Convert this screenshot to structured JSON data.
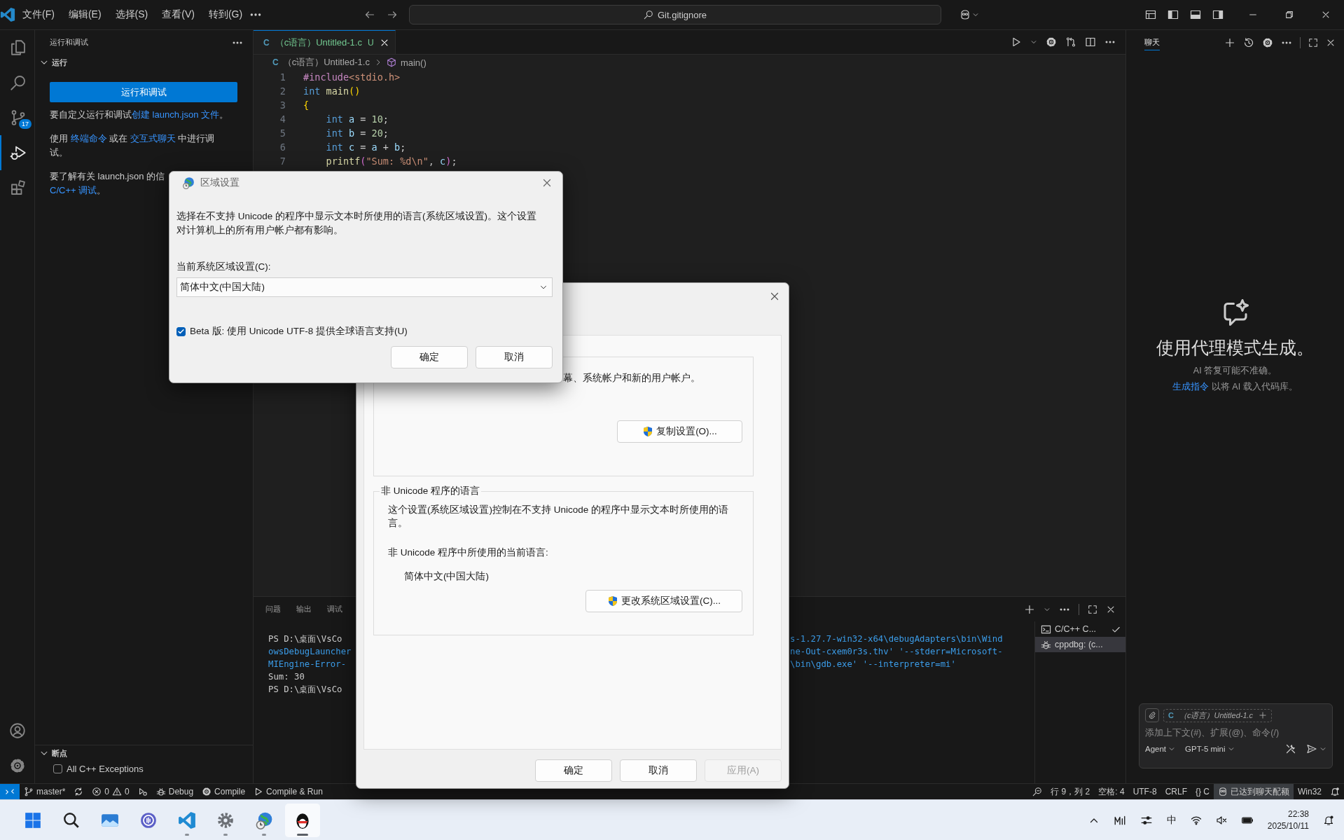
{
  "title_bar": {
    "menus": [
      "文件(F)",
      "编辑(E)",
      "选择(S)",
      "查看(V)",
      "转到(G)"
    ],
    "search": "Git.gitignore"
  },
  "activity_bar": {
    "items": [
      {
        "selected": false
      },
      {
        "selected": false
      },
      {
        "selected": false,
        "badge": "17"
      },
      {
        "selected": true
      },
      {
        "selected": false
      }
    ]
  },
  "sidebar": {
    "title": "运行和调试",
    "section": {
      "title": "运行",
      "expanded": true
    },
    "run_button": "运行和调试",
    "paragraphs": [
      {
        "lines": [
          [
            {
              "text": "要自定义运行和调试",
              "link": false
            },
            {
              "text": "创建 launch.json 文件",
              "link": true
            },
            {
              "text": "。",
              "link": false
            }
          ]
        ]
      },
      {
        "lines": [
          [
            {
              "text": "使用 ",
              "link": false
            },
            {
              "text": "终端命令",
              "link": true
            },
            {
              "text": " 或在 ",
              "link": false
            },
            {
              "text": "交互式聊天",
              "link": true
            },
            {
              "text": " 中进行调",
              "link": false
            }
          ],
          [
            {
              "text": "试。",
              "link": false
            }
          ]
        ]
      },
      {
        "lines": [
          [
            {
              "text": "要了解有关 launch.json 的信",
              "link": false
            }
          ],
          [
            {
              "text": "C/C++ 调试",
              "link": true
            },
            {
              "text": "。",
              "link": false
            }
          ]
        ]
      }
    ],
    "breakpoints": {
      "title": "断点",
      "expanded": true,
      "items": [
        {
          "label": "All C++ Exceptions",
          "checked": false
        }
      ]
    }
  },
  "editor": {
    "tabs": [
      {
        "lang": "C",
        "label": "（c语言）Untitled-1.c",
        "status": "U",
        "selected": true
      }
    ],
    "breadcrumb": {
      "lang": "C",
      "file": "（c语言）Untitled-1.c",
      "symbol": "main()"
    },
    "lines": [
      {
        "number": "1",
        "tokens": [
          {
            "kind": "preproc",
            "text": "#include"
          },
          {
            "kind": "string",
            "text": "<stdio.h>"
          }
        ]
      },
      {
        "number": "2",
        "tokens": [
          {
            "kind": "keyword",
            "text": "int"
          },
          {
            "kind": "func",
            "text": " main"
          },
          {
            "kind": "bracket1",
            "text": "()"
          }
        ]
      },
      {
        "number": "3",
        "tokens": [
          {
            "kind": "bracket1",
            "text": "{"
          }
        ]
      },
      {
        "number": "4",
        "tokens": [
          {
            "kind": "keyword",
            "text": "    int"
          },
          {
            "kind": "var",
            "text": " a"
          },
          {
            "kind": "plain",
            "text": " = "
          },
          {
            "kind": "number",
            "text": "10"
          },
          {
            "kind": "plain",
            "text": ";"
          }
        ]
      },
      {
        "number": "5",
        "tokens": [
          {
            "kind": "keyword",
            "text": "    int"
          },
          {
            "kind": "var",
            "text": " b"
          },
          {
            "kind": "plain",
            "text": " = "
          },
          {
            "kind": "number",
            "text": "20"
          },
          {
            "kind": "plain",
            "text": ";"
          }
        ]
      },
      {
        "number": "6",
        "tokens": [
          {
            "kind": "keyword",
            "text": "    int"
          },
          {
            "kind": "var",
            "text": " c"
          },
          {
            "kind": "plain",
            "text": " = "
          },
          {
            "kind": "var",
            "text": "a"
          },
          {
            "kind": "plain",
            "text": " + "
          },
          {
            "kind": "var",
            "text": "b"
          },
          {
            "kind": "plain",
            "text": ";"
          }
        ]
      },
      {
        "number": "7",
        "tokens": [
          {
            "kind": "func",
            "text": "    printf"
          },
          {
            "kind": "bracket2",
            "text": "("
          },
          {
            "kind": "string",
            "text": "\"Sum: %d\\n\""
          },
          {
            "kind": "plain",
            "text": ", "
          },
          {
            "kind": "var",
            "text": "c"
          },
          {
            "kind": "bracket2",
            "text": ")"
          },
          {
            "kind": "plain",
            "text": ";"
          }
        ]
      }
    ]
  },
  "panel": {
    "tabs": [
      {
        "label": "问题",
        "selected": false
      },
      {
        "label": "输出",
        "selected": false
      },
      {
        "label": "调试",
        "selected": false
      }
    ],
    "terminal": [
      {
        "parts": [
          {
            "kind": "prompt",
            "text": "PS D:\\桌面\\VsCo"
          },
          {
            "kind": "command",
            "text": "s-1.27.7-win32-x64\\debugAdapters\\bin\\Wind"
          }
        ]
      },
      {
        "parts": [
          {
            "kind": "command",
            "text": "owsDebugLauncher"
          },
          {
            "kind": "command",
            "text": "ne-Out-cxem0r3s.thv' '--stderr=Microsoft-"
          }
        ]
      },
      {
        "parts": [
          {
            "kind": "command",
            "text": "MIEngine-Error-"
          },
          {
            "kind": "command",
            "text": "\\bin\\gdb.exe' '--interpreter=mi'"
          }
        ]
      },
      {
        "parts": [
          {
            "kind": "output",
            "text": "Sum: 30"
          }
        ]
      },
      {
        "parts": [
          {
            "kind": "prompt",
            "text": "PS D:\\桌面\\VsCo"
          }
        ]
      }
    ],
    "terminals": [
      {
        "kind": "terminal",
        "label": "C/C++ C...",
        "selected": false,
        "check": true
      },
      {
        "kind": "debug",
        "label": "cppdbg: (c...",
        "selected": true,
        "check": false
      }
    ]
  },
  "chat": {
    "tabs": [
      {
        "label": "聊天",
        "selected": true
      }
    ],
    "heading": "使用代理模式生成。",
    "note": "AI 答复可能不准确。",
    "hint": [
      {
        "text": "生成指令",
        "link": true
      },
      {
        "text": " 以将 AI 载入代码库。",
        "link": false
      }
    ],
    "input": {
      "context": {
        "lang": "C",
        "file": "（c语言）Untitled-1.c"
      },
      "placeholder": "添加上下文(#)、扩展(@)、命令(/)",
      "mode": "Agent",
      "model": "GPT-5 mini"
    }
  },
  "status_bar": {
    "left": [
      {
        "kind": "branch",
        "text": "master*"
      },
      {
        "kind": "sync"
      },
      {
        "kind": "problems",
        "errors": "0",
        "warnings": "0"
      },
      {
        "kind": "launch"
      },
      {
        "kind": "bug",
        "text": "Debug"
      },
      {
        "kind": "gear",
        "text": "Compile"
      },
      {
        "kind": "play",
        "text": "Compile & Run"
      }
    ],
    "right": [
      {
        "kind": "zoom"
      },
      {
        "kind": "text",
        "text": "行 9，列 2"
      },
      {
        "kind": "text",
        "text": "空格: 4"
      },
      {
        "kind": "text",
        "text": "UTF-8"
      },
      {
        "kind": "text",
        "text": "CRLF"
      },
      {
        "kind": "text",
        "text": "{} C"
      },
      {
        "kind": "quota",
        "text": "已达到聊天配额"
      },
      {
        "kind": "text",
        "text": "Win32"
      },
      {
        "kind": "bell"
      }
    ]
  },
  "taskbar": {
    "apps": [
      {
        "running": false,
        "active": false
      },
      {
        "running": false,
        "active": false
      },
      {
        "running": false,
        "active": false
      },
      {
        "running": false,
        "active": false
      },
      {
        "running": true,
        "active": false
      },
      {
        "running": true,
        "active": false
      },
      {
        "running": true,
        "active": false
      },
      {
        "running": true,
        "active": true
      }
    ],
    "input_method": "中",
    "time": "22:38",
    "date": "2025/10/11"
  },
  "region_window": {
    "copy_text": "幕、系统帐户和新的用户帐户。",
    "copy_button": "复制设置(O)...",
    "group_title": "非 Unicode 程序的语言",
    "group_text": "这个设置(系统区域设置)控制在不支持 Unicode 的程序中显示文本时所使用的语言。",
    "current_label": "非 Unicode 程序中所使用的当前语言:",
    "current_value": "简体中文(中国大陆)",
    "change_button": "更改系统区域设置(C)...",
    "buttons": [
      {
        "label": "确定",
        "disabled": false
      },
      {
        "label": "取消",
        "disabled": false
      },
      {
        "label": "应用(A)",
        "disabled": true
      }
    ]
  },
  "region_dialog": {
    "title": "区域设置",
    "description": "选择在不支持 Unicode 的程序中显示文本时所使用的语言(系统区域设置)。这个设置对计算机上的所有用户帐户都有影响。",
    "locale_label": "当前系统区域设置(C):",
    "locale_value": "简体中文(中国大陆)",
    "utf8": {
      "label": "Beta 版: 使用 Unicode UTF-8 提供全球语言支持(U)",
      "checked": true
    },
    "buttons": [
      "确定",
      "取消"
    ]
  }
}
